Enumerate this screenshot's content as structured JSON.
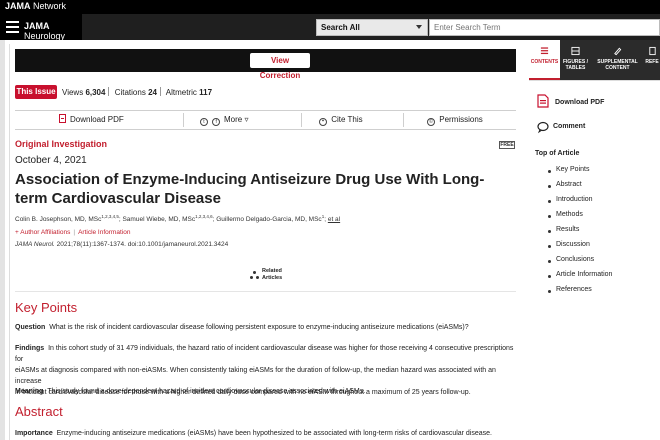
{
  "network": {
    "brand_bold": "JAMA",
    "brand_rest": " Network"
  },
  "journal": {
    "name_bold": "JAMA",
    "name_rest": " Neurology"
  },
  "search": {
    "scope": "Search All",
    "placeholder": "Enter Search Term"
  },
  "correction": {
    "label": "View Correction"
  },
  "metrics": {
    "issue_label": "This Issue",
    "views_label": "Views",
    "views": "6,304",
    "citations_label": "Citations",
    "citations": "24",
    "altmetric_label": "Altmetric",
    "altmetric": "117"
  },
  "actions": {
    "download_pdf": "Download PDF",
    "more": "More",
    "cite": "Cite This",
    "permissions": "Permissions"
  },
  "article": {
    "type": "Original Investigation",
    "free": "FREE",
    "date": "October 4, 2021",
    "title": "Association of Enzyme-Inducing Antiseizure Drug Use With Long-term Cardiovascular Disease",
    "author1": "Colin B. Josephson, MD, MSc",
    "author1_sup": "1,2,3,4,5",
    "author2": "; Samuel Wiebe, MD, MSc",
    "author2_sup": "1,2,3,4,6",
    "author3": "; Guillermo Delgado-Garcia, MD, MSc",
    "author3_sup": "1",
    "author_more": "; ",
    "et_al": "et al",
    "affiliations": "Author Affiliations",
    "article_info": "Article Information",
    "journal_abbrev": "JAMA Neurol.",
    "citation": " 2021;78(11):1367-1374. doi:10.1001/jamaneurol.2021.3424",
    "related_line1": "Related",
    "related_line2": "Articles"
  },
  "key_points": {
    "heading": "Key Points",
    "question_label": "Question",
    "question": "What is the risk of incident cardiovascular disease following persistent exposure to enzyme-inducing antiseizure medications (eiASMs)?",
    "findings_label": "Findings",
    "findings_1": "In this cohort study of 31 479 individuals, the hazard ratio of incident cardiovascular disease was higher for those receiving 4 consecutive prescriptions for",
    "findings_2": "eiASMs at diagnosis compared with non-eiASMs. When consistently taking eiASMs for the duration of follow-up, the median hazard was associated with an increase",
    "findings_3": "in incident cardiovascular disease for those with a higher defined daily dose compared with no eiASM throughout a maximum of 25 years follow-up.",
    "meaning_label": "Meaning",
    "meaning": "This study found a dose-dependent hazard of incident cardiovascular disease associated with eiASMs."
  },
  "abstract": {
    "heading": "Abstract",
    "importance_label": "Importance",
    "importance": "Enzyme-inducing antiseizure medications (eiASMs) have been hypothesized to be associated with long-term risks of cardiovascular disease."
  },
  "right_panel": {
    "tabs": [
      {
        "label": "CONTENTS"
      },
      {
        "label_1": "FIGURES /",
        "label_2": "TABLES"
      },
      {
        "label_1": "SUPPLEMENTAL",
        "label_2": "CONTENT"
      },
      {
        "label": "REFE"
      }
    ],
    "download_pdf": "Download PDF",
    "comment": "Comment",
    "toc_title": "Top of Article",
    "toc": [
      "Key Points",
      "Abstract",
      "Introduction",
      "Methods",
      "Results",
      "Discussion",
      "Conclusions",
      "Article Information",
      "References"
    ]
  },
  "colors": {
    "accent": "#c21f2e",
    "header": "#1f1f1f",
    "badge": "#c8102e"
  },
  "icons": [
    "menu-icon",
    "caret-down-icon",
    "pdf-icon",
    "share-icon",
    "more-icon",
    "cite-icon",
    "permissions-icon",
    "related-articles-icon",
    "contents-icon",
    "figures-icon",
    "supplemental-icon",
    "comment-icon"
  ]
}
